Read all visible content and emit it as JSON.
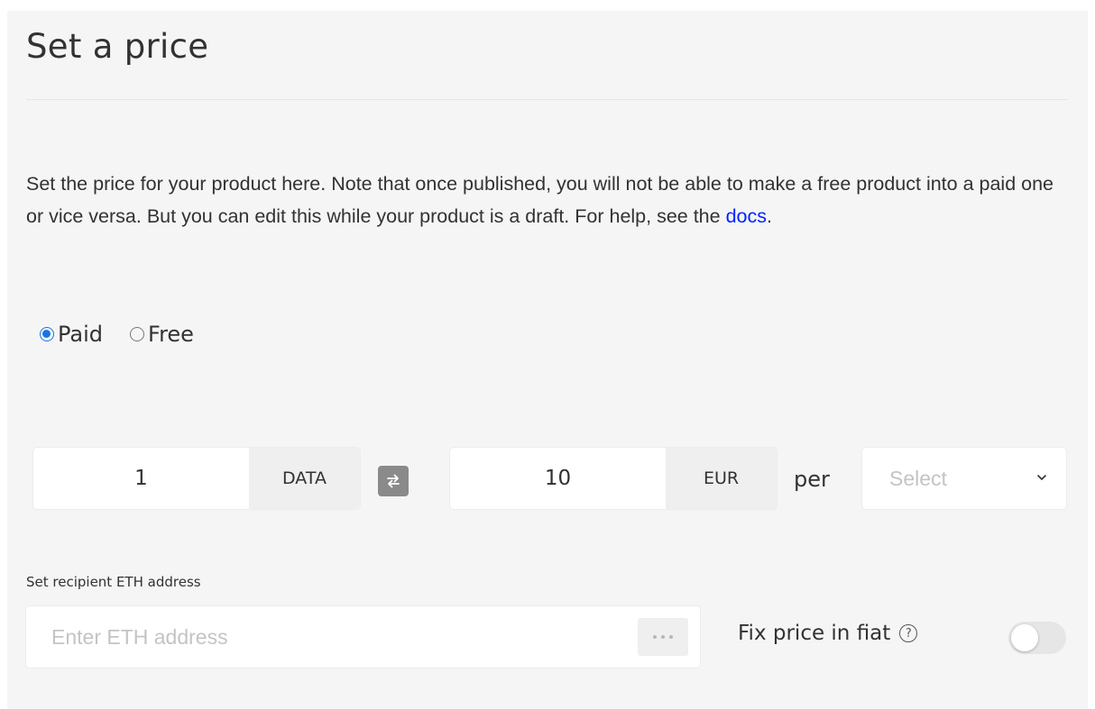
{
  "section": {
    "title": "Set a price",
    "description_part1": "Set the price for your product here. Note that once published, you will not be able to make a free product into a paid one or vice versa. But you can edit this while your product is a draft. For help, see the ",
    "docs_link": "docs",
    "description_end": "."
  },
  "pricing_type": {
    "options": [
      "Paid",
      "Free"
    ],
    "selected": "Paid"
  },
  "price": {
    "data_amount": "1",
    "data_unit": "DATA",
    "fiat_amount": "10",
    "fiat_unit": "EUR",
    "per_label": "per",
    "time_unit_placeholder": "Select"
  },
  "recipient": {
    "label": "Set recipient ETH address",
    "placeholder": "Enter ETH address",
    "value": ""
  },
  "fix_price": {
    "label": "Fix price in fiat",
    "help_glyph": "?",
    "enabled": false
  },
  "colors": {
    "link": "#0324ff",
    "radio_accent": "#1a73e8",
    "panel_bg": "#f5f5f5"
  }
}
